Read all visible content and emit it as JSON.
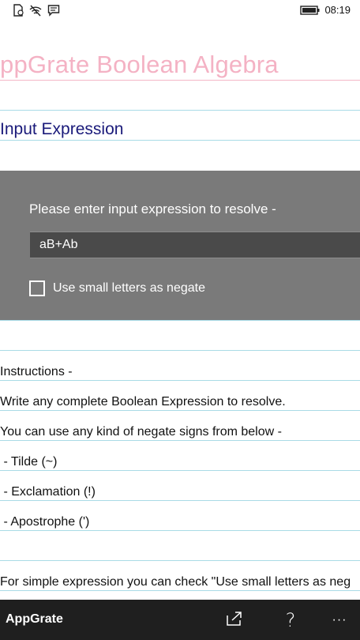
{
  "status_bar": {
    "time": "08:19",
    "icons": [
      "sim-icon",
      "wifi-icon",
      "message-icon",
      "battery-icon"
    ]
  },
  "app": {
    "title": "ppGrate Boolean Algebra"
  },
  "section": {
    "heading": "Input Expression"
  },
  "input_panel": {
    "prompt": "Please enter input expression to resolve -",
    "expression_value": "aB+Ab",
    "checkbox_label": "Use small letters as negate",
    "checkbox_checked": false
  },
  "instructions": {
    "lines": [
      "Instructions -",
      "Write any complete Boolean Expression to resolve.",
      "You can use any kind of negate signs from below -",
      " - Tilde (~)",
      " - Exclamation (!)",
      " - Apostrophe (')",
      "",
      "For simple expression you can check \"Use small letters as neg"
    ]
  },
  "app_bar": {
    "title": "AppGrate",
    "buttons": [
      "share-icon",
      "help-icon",
      "more-icon"
    ],
    "help_glyph": "?",
    "more_glyph": "···"
  },
  "colors": {
    "title_pink": "#f4b2c4",
    "heading_navy": "#1a1a7a",
    "line_blue": "#a9dbe6",
    "panel_gray": "#7a7a7a",
    "input_dark": "#4a4a4a",
    "appbar_dark": "#1f1f1f"
  }
}
